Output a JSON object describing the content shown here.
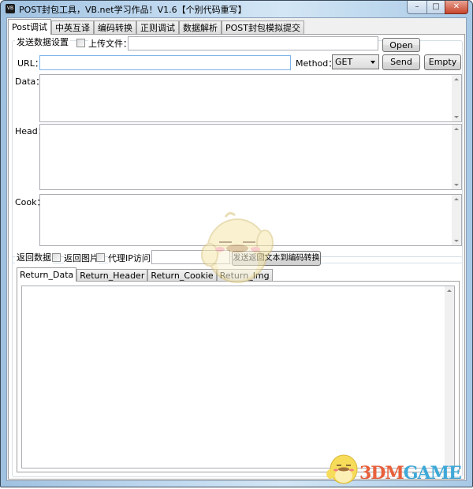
{
  "window": {
    "title": "POST封包工具，VB.net学习作品！V1.6【个别代码重写】",
    "icon_label": "VB",
    "controls": {
      "minimize": "–",
      "maximize": "□",
      "close": "✕"
    }
  },
  "main_tabs": [
    {
      "label": "Post调试",
      "active": true
    },
    {
      "label": "中英互译",
      "active": false
    },
    {
      "label": "编码转换",
      "active": false
    },
    {
      "label": "正则调试",
      "active": false
    },
    {
      "label": "数据解析",
      "active": false
    },
    {
      "label": "POST封包模拟提交",
      "active": false
    }
  ],
  "send_settings": {
    "group_label": "发送数据设置",
    "upload_file_label": "上传文件：",
    "upload_file_checked": false,
    "upload_file_value": "",
    "open_button": "Open",
    "url_label": "URL：",
    "url_value": "",
    "method_label": "Method：",
    "method_value": "GET",
    "send_button": "Send",
    "empty_button": "Empty",
    "data_label": "Data：",
    "data_value": "",
    "head_label": "Head：",
    "head_value": "",
    "cook_label": "Cook：",
    "cook_value": ""
  },
  "return_section": {
    "group_label": "返回数据",
    "return_image_label": "返回图片",
    "return_image_checked": false,
    "proxy_label": "代理IP访问：",
    "proxy_checked": false,
    "proxy_value": "",
    "send_to_encode_button": "发送返回文本到编码转换",
    "tabs": [
      {
        "label": "Return_Data",
        "active": true
      },
      {
        "label": "Return_Header",
        "active": false
      },
      {
        "label": "Return_Cookie",
        "active": false
      },
      {
        "label": "Return_Img",
        "active": false
      }
    ],
    "content": ""
  },
  "watermark": {
    "text_part1": "3DM",
    "text_part2": "GAME",
    "color1": "#e8603c",
    "color2": "#3fa9d8"
  }
}
